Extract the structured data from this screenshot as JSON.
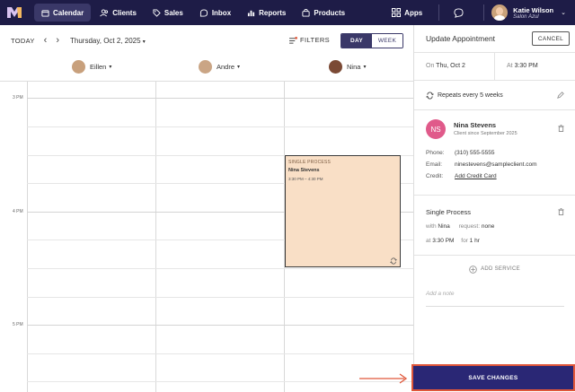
{
  "nav": {
    "items": [
      {
        "label": "Calendar",
        "icon": "calendar-icon",
        "active": true
      },
      {
        "label": "Clients",
        "icon": "clients-icon"
      },
      {
        "label": "Sales",
        "icon": "tag-icon"
      },
      {
        "label": "Inbox",
        "icon": "inbox-icon"
      },
      {
        "label": "Reports",
        "icon": "chart-icon"
      },
      {
        "label": "Products",
        "icon": "bag-icon"
      }
    ],
    "apps_label": "Apps",
    "user_name": "Katie Wilson",
    "user_salon": "Salon Azul"
  },
  "toolbar": {
    "today_label": "TODAY",
    "date_label": "Thursday, Oct 2, 2025",
    "filters_label": "FILTERS",
    "day_label": "DAY",
    "week_label": "WEEK"
  },
  "staff": [
    {
      "name": "Eillen",
      "avatar_color": "#c8a07c"
    },
    {
      "name": "Andre",
      "avatar_color": "#caa585"
    },
    {
      "name": "Nina",
      "avatar_color": "#7b4a35"
    }
  ],
  "times": {
    "t3": "3 PM",
    "t4": "4 PM",
    "t5": "5 PM"
  },
  "appointment": {
    "service": "SINGLE PROCESS",
    "client": "Nina Stevens",
    "time": "3:30 PM – 4:30 PM"
  },
  "panel": {
    "title": "Update Appointment",
    "cancel_label": "CANCEL",
    "on_label": "On",
    "date_value": "Thu, Oct 2",
    "at_label": "At",
    "time_value": "3:30 PM",
    "repeat_text": "Repeats every 5 weeks",
    "client_initials": "NS",
    "client_name": "Nina Stevens",
    "client_since": "Client since September 2025",
    "phone_label": "Phone:",
    "phone_value": "(310) 555-5555",
    "email_label": "Email:",
    "email_value": "ninestevens@sampleclient.com",
    "credit_label": "Credit:",
    "credit_link": "Add Credit Card",
    "service_name": "Single Process",
    "with_label": "with",
    "with_value": "Nina",
    "request_label": "request:",
    "request_value": "none",
    "at_label2": "at",
    "svc_time": "3:30 PM",
    "for_label": "for",
    "duration": "1 hr",
    "add_service_label": "ADD SERVICE",
    "note_placeholder": "Add a note",
    "save_label": "SAVE CHANGES"
  },
  "colors": {
    "nav_bg": "#1e1c47",
    "accent": "#2a2775",
    "appt_bg": "#f9dfc6",
    "highlight": "#e0573a",
    "client_avatar": "#e05a8a"
  }
}
